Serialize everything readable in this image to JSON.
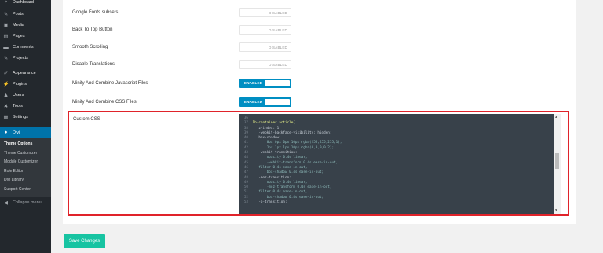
{
  "sidebar": {
    "items": [
      {
        "label": "Dashboard",
        "icon": "dashboard-icon"
      },
      {
        "label": "Posts",
        "icon": "pin-icon"
      },
      {
        "label": "Media",
        "icon": "media-icon"
      },
      {
        "label": "Pages",
        "icon": "page-icon"
      },
      {
        "label": "Comments",
        "icon": "comment-icon"
      },
      {
        "label": "Projects",
        "icon": "pin-icon"
      },
      {
        "label": "Appearance",
        "icon": "brush-icon"
      },
      {
        "label": "Plugins",
        "icon": "plugin-icon"
      },
      {
        "label": "Users",
        "icon": "user-icon"
      },
      {
        "label": "Tools",
        "icon": "wrench-icon"
      },
      {
        "label": "Settings",
        "icon": "settings-icon"
      }
    ],
    "active": {
      "label": "Divi",
      "icon": "divi-icon"
    },
    "submenu": [
      "Theme Options",
      "Theme Customizer",
      "Module Customizer",
      "Role Editor",
      "Divi Library",
      "Support Center"
    ],
    "collapse_label": "Collapse menu"
  },
  "options": [
    {
      "label": "Google Fonts subsets",
      "state": "DISABLED"
    },
    {
      "label": "Back To Top Button",
      "state": "DISABLED"
    },
    {
      "label": "Smooth Scrolling",
      "state": "DISABLED"
    },
    {
      "label": "Disable Translations",
      "state": "DISABLED"
    },
    {
      "label": "Minify And Combine Javascript Files",
      "state": "ENABLED"
    },
    {
      "label": "Minify And Combine CSS Files",
      "state": "ENABLED"
    }
  ],
  "custom_css": {
    "label": "Custom CSS",
    "lines": [
      {
        "n": "36",
        "t": ""
      },
      {
        "n": "37",
        "t": ".lb-container article{"
      },
      {
        "n": "38",
        "t": "    z-index: 1;"
      },
      {
        "n": "39",
        "t": "    -webkit-backface-visibility: hidden;"
      },
      {
        "n": "40",
        "t": "    box-shadow:"
      },
      {
        "n": "41",
        "t": "        0px 0px 0px 10px rgba(255,255,255,1),"
      },
      {
        "n": "42",
        "t": "        1px 1px 1px 10px rgba(0,0,0,0.2);"
      },
      {
        "n": "43",
        "t": "    -webkit-transition:"
      },
      {
        "n": "44",
        "t": "        opacity 0.4s linear,"
      },
      {
        "n": "45",
        "t": "        -webkit-transform 0.4s ease-in-out,"
      },
      {
        "n": "46",
        "t": "    filter 0.4s ease-in-out,"
      },
      {
        "n": "47",
        "t": "        box-shadow 0.4s ease-in-out;"
      },
      {
        "n": "48",
        "t": "    -moz-transition:"
      },
      {
        "n": "49",
        "t": "        opacity 0.4s linear,"
      },
      {
        "n": "50",
        "t": "        -moz-transform 0.4s ease-in-out,"
      },
      {
        "n": "51",
        "t": "    filter 0.4s ease-in-out,"
      },
      {
        "n": "52",
        "t": "        box-shadow 0.4s ease-in-out;"
      },
      {
        "n": "53",
        "t": "    -o-transition:"
      }
    ]
  },
  "save_label": "Save Changes",
  "colors": {
    "sidebar_bg": "#23282d",
    "active_bg": "#0073aa",
    "toggle_on": "#008ec2",
    "highlight_border": "#e0232a",
    "save_button": "#17c4a2",
    "editor_bg": "#38414a"
  }
}
